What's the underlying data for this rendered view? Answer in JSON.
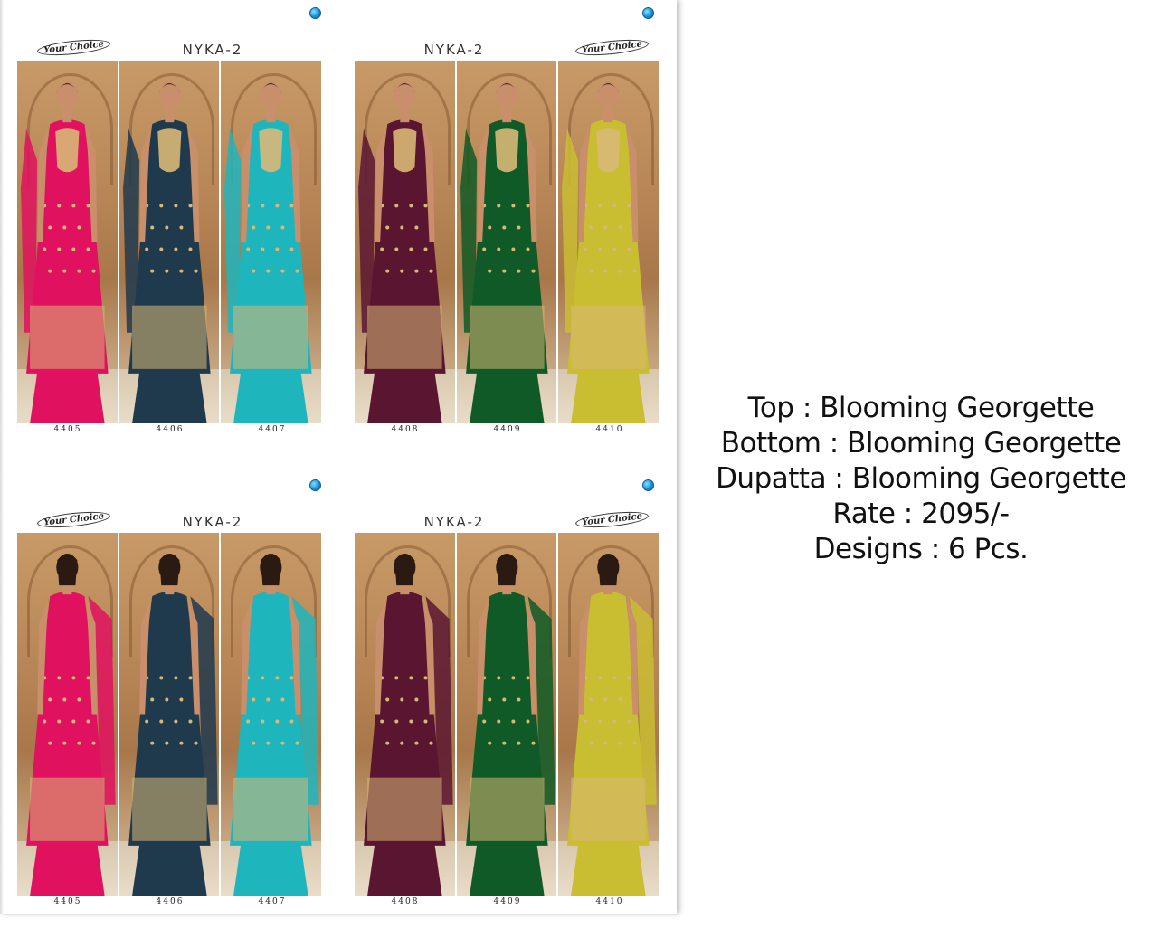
{
  "panels": [
    {
      "title": "NYKA-2",
      "brand": "Your Choice",
      "view": "front",
      "designs": [
        {
          "number": "4405",
          "color": "#e0115f"
        },
        {
          "number": "4406",
          "color": "#1f3a4d"
        },
        {
          "number": "4407",
          "color": "#1fb5bd"
        }
      ]
    },
    {
      "title": "NYKA-2",
      "brand": "Your Choice",
      "view": "front",
      "designs": [
        {
          "number": "4408",
          "color": "#5a1631"
        },
        {
          "number": "4409",
          "color": "#0f5a26"
        },
        {
          "number": "4410",
          "color": "#c9bd32"
        }
      ]
    },
    {
      "title": "NYKA-2",
      "brand": "Your Choice",
      "view": "back",
      "designs": [
        {
          "number": "4405",
          "color": "#e0115f"
        },
        {
          "number": "4406",
          "color": "#1f3a4d"
        },
        {
          "number": "4407",
          "color": "#1fb5bd"
        }
      ]
    },
    {
      "title": "NYKA-2",
      "brand": "Your Choice",
      "view": "back",
      "designs": [
        {
          "number": "4408",
          "color": "#5a1631"
        },
        {
          "number": "4409",
          "color": "#0f5a26"
        },
        {
          "number": "4410",
          "color": "#c9bd32"
        }
      ]
    }
  ],
  "details": {
    "top": "Top : Blooming Georgette",
    "bottom": "Bottom : Blooming Georgette",
    "dupatta": "Dupatta : Blooming Georgette",
    "rate": "Rate : 2095/-",
    "designs": "Designs : 6 Pcs."
  },
  "colors": {
    "embroidery": "#d8b877",
    "skin": "#c98f6b",
    "hair": "#2a1a12"
  }
}
